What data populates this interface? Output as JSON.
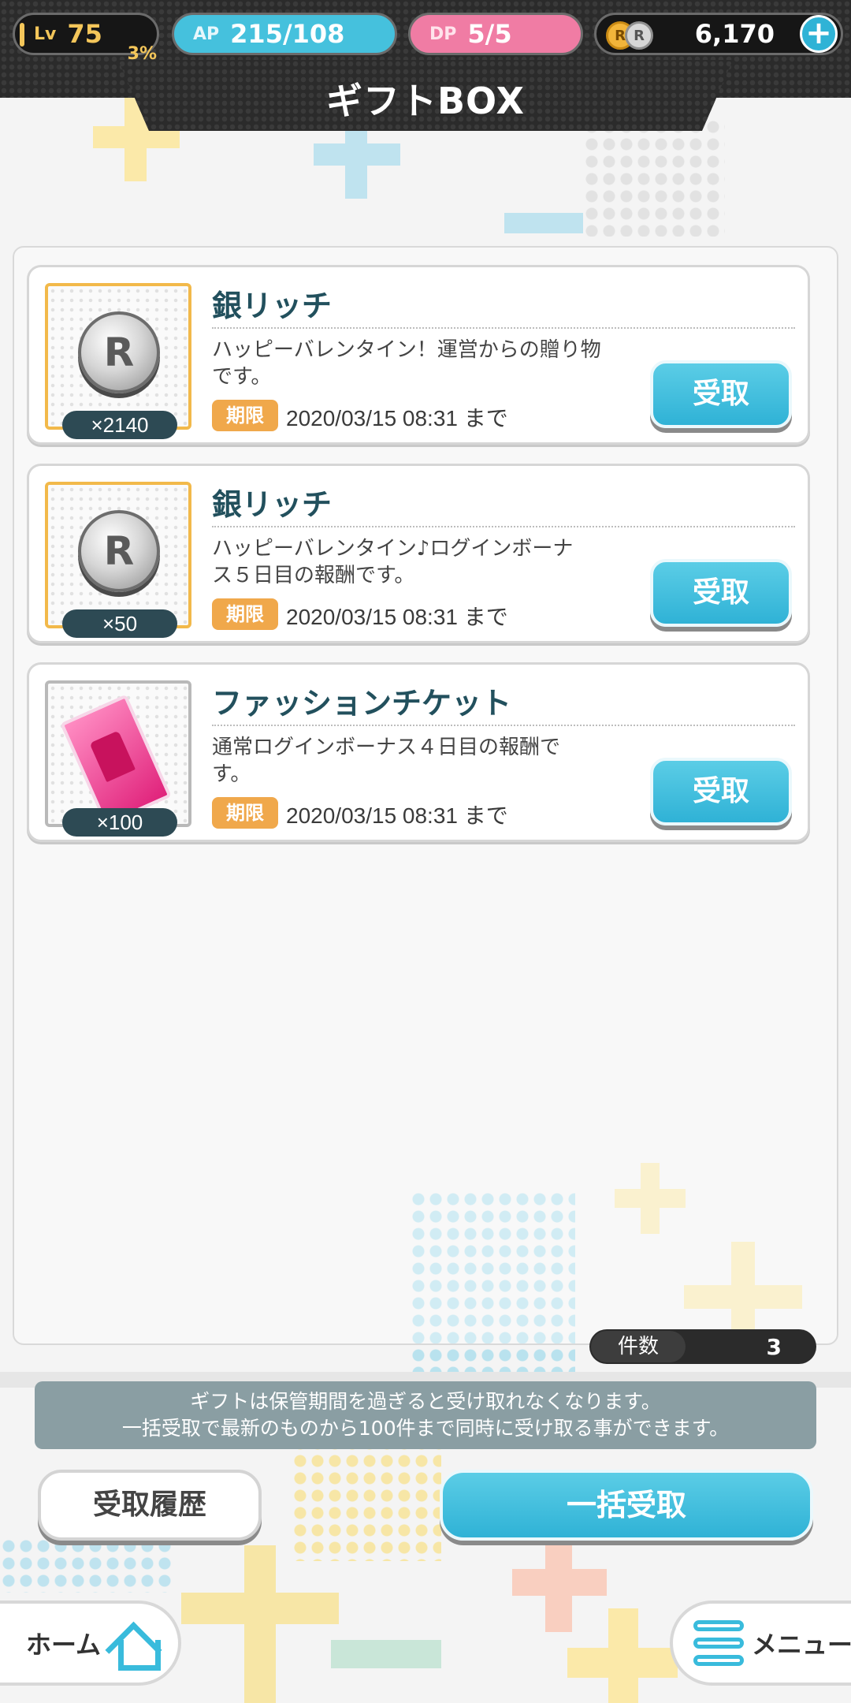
{
  "status": {
    "lv_label": "Lv",
    "lv_value": "75",
    "lv_progress": "3%",
    "ap_label": "AP",
    "ap_value": "215/108",
    "dp_label": "DP",
    "dp_value": "5/5",
    "coin_gold": "R",
    "coin_silver": "R",
    "coins": "6,170",
    "plus": "+"
  },
  "title": "ギフトBOX",
  "gifts": [
    {
      "name": "銀リッチ",
      "quantity": "×2140",
      "desc_line1": "ハッピーバレンタイン！運営からの贈り物",
      "desc_line2": "です。",
      "icon_letter": "R",
      "limit_label": "期限",
      "limit_text": "2020/03/15 08:31 まで",
      "receive_label": "受取"
    },
    {
      "name": "銀リッチ",
      "quantity": "×50",
      "desc_line1": "ハッピーバレンタイン♪ログインボーナ",
      "desc_line2": "ス５日目の報酬です。",
      "icon_letter": "R",
      "limit_label": "期限",
      "limit_text": "2020/03/15 08:31 まで",
      "receive_label": "受取"
    },
    {
      "name": "ファッションチケット",
      "quantity": "×100",
      "desc_line1": "通常ログインボーナス４日目の報酬で",
      "desc_line2": "す。",
      "limit_label": "期限",
      "limit_text": "2020/03/15 08:31 まで",
      "receive_label": "受取"
    }
  ],
  "count": {
    "label": "件数",
    "value": "3"
  },
  "notice": {
    "line1": "ギフトは保管期間を過ぎると受け取れなくなります。",
    "line2": "一括受取で最新のものから100件まで同時に受け取る事ができます。"
  },
  "buttons": {
    "history": "受取履歴",
    "bulk_receive": "一括受取"
  },
  "nav": {
    "home": "ホーム",
    "menu": "メニュー"
  },
  "colors": {
    "accent_blue": "#39bbdc",
    "badge_orange": "#f0a84b",
    "title_teal": "#22505d"
  }
}
